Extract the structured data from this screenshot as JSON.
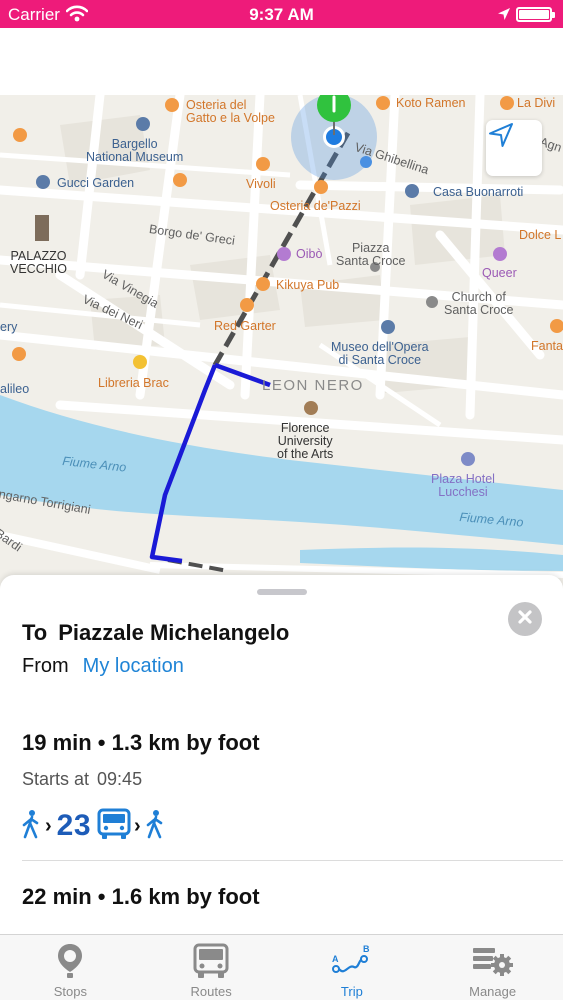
{
  "status_bar": {
    "carrier": "Carrier",
    "time": "9:37 AM"
  },
  "map": {
    "pois": {
      "osteria_gatto": "Osteria del\nGatto e la Volpe",
      "koto_ramen": "Koto Ramen",
      "la_divina": "La Divi",
      "bargello": "Bargello\nNational Museum",
      "via_ghibellina": "Via Ghibellina",
      "l_agnolo": "l'Agn",
      "gucci_garden": "Gucci Garden",
      "vivoli": "Vivoli",
      "casa_buonarroti": "Casa Buonarroti",
      "osteria_pazzi": "Osteria de'Pazzi",
      "borgo_greci": "Borgo de' Greci",
      "dolce": "Dolce L",
      "palazzo_vecchio": "PALAZZO\nVECCHIO",
      "oibo": "Oibò",
      "piazza_santa_croce": "Piazza\nSanta Croce",
      "queer": "Queer",
      "via_vinegia": "Via Vinegia",
      "kikuya": "Kikuya Pub",
      "church_santa_croce": "Church of\nSanta Croce",
      "via_neri": "Via dei Neri",
      "ery": "ery",
      "red_garter": "Red Garter",
      "fanta": "Fanta",
      "museo_opera": "Museo dell'Opera\ndi Santa Croce",
      "libreria": "Libreria Brac",
      "leon_nero": "LEON NERO",
      "galileo": "alileo",
      "florence_university": "Florence\nUniversity\nof the Arts",
      "fiume_arno_1": "Fiume Arno",
      "plaza_hotel": "Plaza Hotel\nLucchesi",
      "torrigiani": "ngarno Torrigiani",
      "fiume_arno_2": "Fiume Arno",
      "bardi": "Bardi"
    }
  },
  "trip": {
    "to_label": "To",
    "destination": "Piazzale Michelangelo",
    "from_label": "From",
    "origin": "My location",
    "routes": [
      {
        "summary": "19 min • 1.3 km by foot",
        "starts_label": "Starts at",
        "start_time": "09:45",
        "bus_line": "23"
      },
      {
        "summary": "22 min • 1.6 km by foot"
      }
    ]
  },
  "tabs": [
    {
      "label": "Stops",
      "icon": "stop-pin-icon"
    },
    {
      "label": "Routes",
      "icon": "bus-icon"
    },
    {
      "label": "Trip",
      "icon": "trip-ab-icon"
    },
    {
      "label": "Manage",
      "icon": "gear-icon"
    }
  ],
  "colors": {
    "status_bar": "#ee1b7a",
    "accent": "#1f7fd6",
    "bus_line": "#1d5cb8",
    "walk_route": "#1a1ad6",
    "river": "#a6d7ee"
  }
}
